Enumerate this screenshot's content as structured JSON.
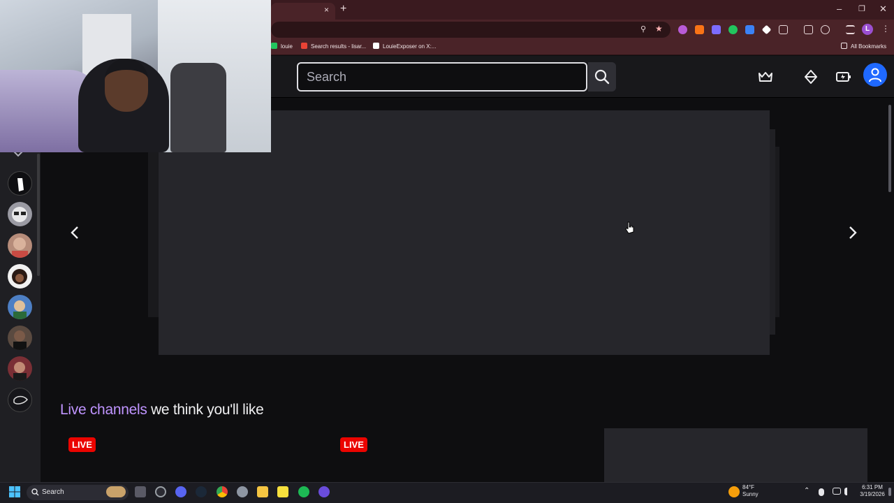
{
  "browser": {
    "bookmarks": [
      {
        "label": "louie",
        "color": "#22c55e"
      },
      {
        "label": "Search results - lisar...",
        "color": "#ea4335"
      },
      {
        "label": "LouieExposer on X:...",
        "color": "#ffffff"
      }
    ],
    "all_bookmarks_label": "All Bookmarks",
    "new_tab_glyph": "+",
    "close_tab_glyph": "×"
  },
  "twitch": {
    "search_placeholder": "Search",
    "icons": [
      "crown-icon",
      "prime-diamond-icon",
      "bits-battery-icon",
      "user-avatar-icon"
    ],
    "section_title_highlight": "Live channels",
    "section_title_rest": " we think you'll like",
    "live_badge": "LIVE",
    "accent_color": "#bf94ff",
    "live_color": "#eb0400"
  },
  "sidebar": {
    "channels": [
      {
        "name": "channel-1",
        "color": "#0f0f12"
      },
      {
        "name": "channel-2",
        "color": "#9a9aa3"
      },
      {
        "name": "channel-3",
        "color": "#b68c7a"
      },
      {
        "name": "channel-4",
        "color": "#f1f1f1"
      },
      {
        "name": "channel-5",
        "color": "#4d7fc4"
      },
      {
        "name": "channel-6",
        "color": "#5a4a40"
      },
      {
        "name": "channel-7",
        "color": "#7a2f35"
      },
      {
        "name": "channel-8",
        "color": "#16161a"
      }
    ]
  },
  "taskbar": {
    "search_label": "Search",
    "weather_temp": "84°F",
    "weather_desc": "Sunny",
    "time": "6:31 PM",
    "date": "3/19/2026"
  }
}
